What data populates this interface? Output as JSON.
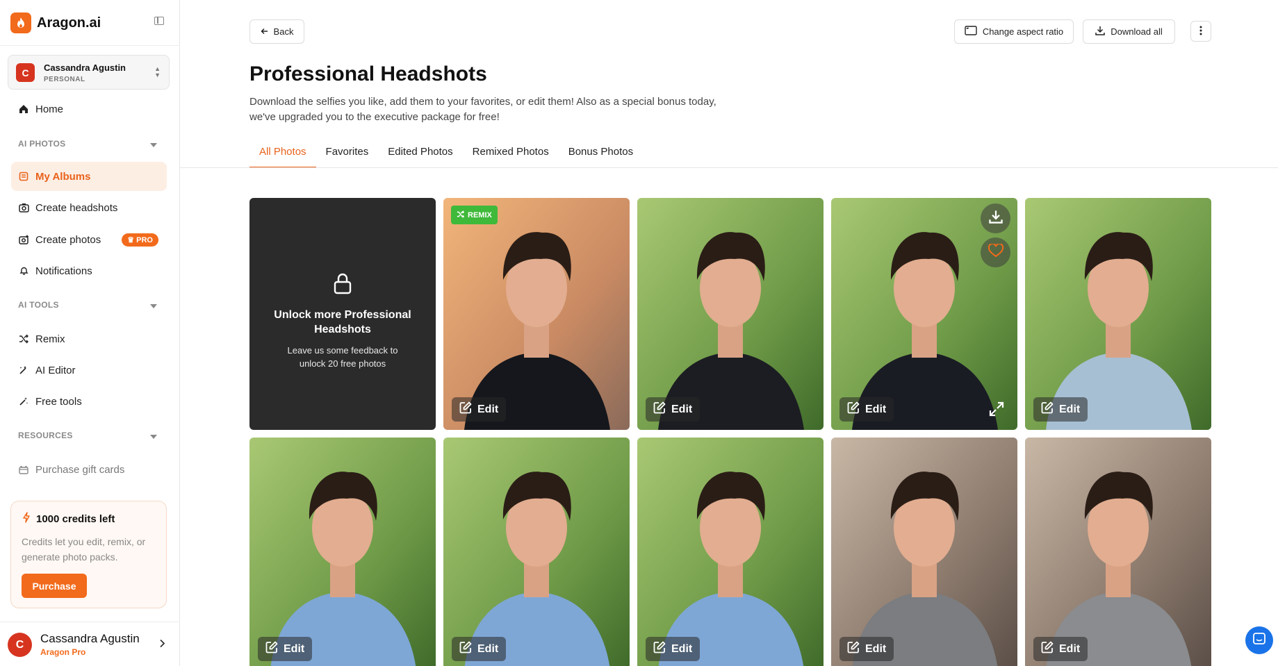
{
  "brand": {
    "name": "Aragon.ai",
    "color": "#f26a1b"
  },
  "account": {
    "initial": "C",
    "name": "Cassandra Agustin",
    "type": "PERSONAL"
  },
  "nav": {
    "home": "Home",
    "ai_photos_label": "AI PHOTOS",
    "my_albums": "My Albums",
    "create_headshots": "Create headshots",
    "create_photos": "Create photos",
    "pro_badge": "PRO",
    "notifications": "Notifications",
    "ai_tools_label": "AI TOOLS",
    "remix": "Remix",
    "ai_editor": "AI Editor",
    "free_tools": "Free tools",
    "resources_label": "RESOURCES",
    "gift_cards": "Purchase gift cards"
  },
  "credits": {
    "title": "1000 credits left",
    "description": "Credits let you edit, remix, or generate photo packs.",
    "purchase_label": "Purchase"
  },
  "footer_user": {
    "initial": "C",
    "name": "Cassandra Agustin",
    "plan": "Aragon Pro"
  },
  "toolbar": {
    "back_label": "Back",
    "aspect_label": "Change aspect ratio",
    "download_all_label": "Download all"
  },
  "page": {
    "title": "Professional Headshots",
    "subtitle": "Download the selfies you like, add them to your favorites, or edit them! Also as a special bonus today, we've upgraded you to the executive package for free!"
  },
  "tabs": [
    "All Photos",
    "Favorites",
    "Edited Photos",
    "Remixed Photos",
    "Bonus Photos"
  ],
  "locked_card": {
    "title": "Unlock more Professional Headshots",
    "description": "Leave us some feedback to unlock 20 free photos"
  },
  "photo_labels": {
    "edit": "Edit",
    "remix_tag": "REMIX"
  },
  "photos": [
    {
      "bg": "sunset",
      "outfit": "tuxedo",
      "remix": true
    },
    {
      "bg": "park",
      "outfit": "black-jacket"
    },
    {
      "bg": "park",
      "outfit": "black-jacket-white",
      "hovered": true
    },
    {
      "bg": "park",
      "outfit": "light-blue-shirt"
    },
    {
      "bg": "park",
      "outfit": "blue-shirt"
    },
    {
      "bg": "park",
      "outfit": "blue-shirt"
    },
    {
      "bg": "park",
      "outfit": "blue-shirt"
    },
    {
      "bg": "city",
      "outfit": "grey-suit"
    },
    {
      "bg": "city",
      "outfit": "grey-suit-dark-tie"
    }
  ],
  "colors": {
    "accent": "#f26a1b",
    "remix_green": "#3fb93a",
    "chat_blue": "#1a73e8"
  }
}
